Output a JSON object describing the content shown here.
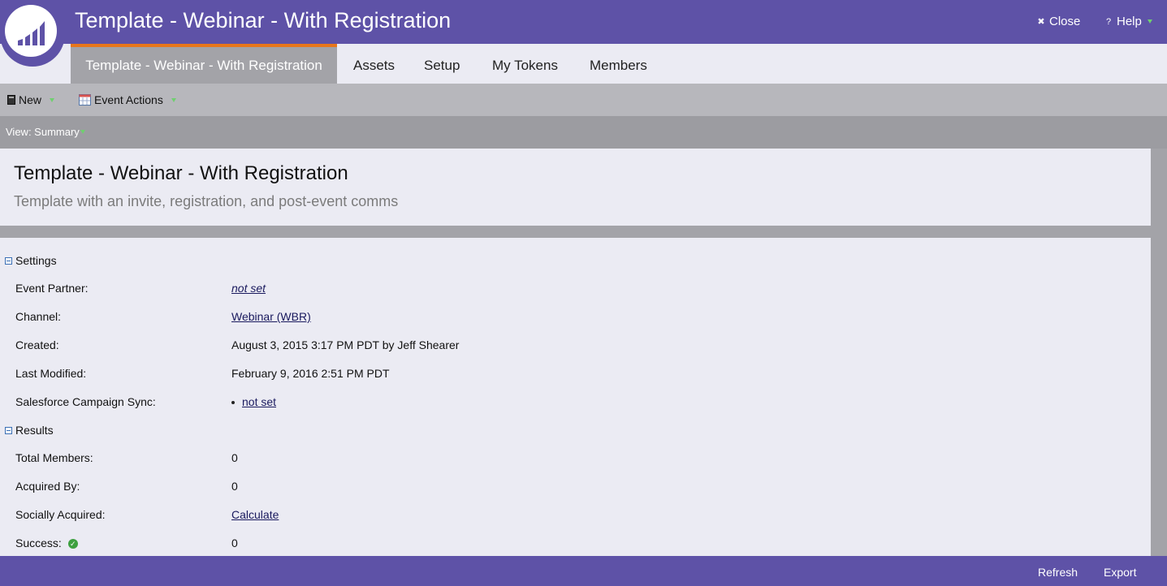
{
  "colors": {
    "brand": "#5e52a7",
    "active_tab_accent": "#e8761b",
    "link": "#1a1a5e",
    "success_green": "#3ea040"
  },
  "header": {
    "logo_icon": "marketo-logo",
    "title": "Template - Webinar - With Registration",
    "close_label": "Close",
    "close_icon": "close-x-icon",
    "help_label": "Help",
    "help_icon": "help-question-icon"
  },
  "tabs": [
    {
      "label": "Template - Webinar - With Registration",
      "active": true
    },
    {
      "label": "Assets",
      "active": false
    },
    {
      "label": "Setup",
      "active": false
    },
    {
      "label": "My Tokens",
      "active": false
    },
    {
      "label": "Members",
      "active": false
    }
  ],
  "toolbar": {
    "new_label": "New",
    "new_icon": "new-document-icon",
    "event_actions_label": "Event Actions",
    "event_actions_icon": "calendar-icon"
  },
  "view": {
    "label": "View: Summary"
  },
  "program": {
    "title": "Template - Webinar - With Registration",
    "description": "Template with an invite, registration, and post-event comms"
  },
  "settings": {
    "heading": "Settings",
    "event_partner_label": "Event Partner:",
    "event_partner_value": "not set",
    "channel_label": "Channel:",
    "channel_value": "Webinar (WBR)",
    "created_label": "Created:",
    "created_value": "August 3, 2015 3:17 PM PDT by Jeff Shearer",
    "modified_label": "Last Modified:",
    "modified_value": "February 9, 2016 2:51 PM PDT",
    "sfdc_label": "Salesforce Campaign Sync:",
    "sfdc_value": "not set"
  },
  "results": {
    "heading": "Results",
    "total_members_label": "Total Members:",
    "total_members_value": "0",
    "acquired_by_label": "Acquired By:",
    "acquired_by_value": "0",
    "socially_acquired_label": "Socially Acquired:",
    "socially_acquired_value": "Calculate",
    "success_label": "Success:",
    "success_icon": "success-check-icon",
    "success_value": "0"
  },
  "footer": {
    "refresh_label": "Refresh",
    "export_label": "Export"
  }
}
